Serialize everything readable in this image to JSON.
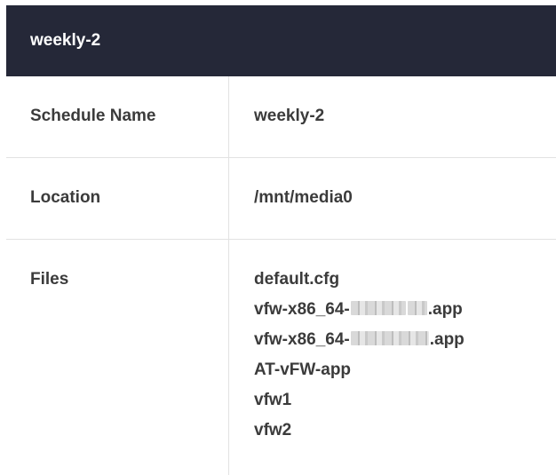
{
  "header": {
    "title": "weekly-2"
  },
  "details": {
    "schedule_name": {
      "label": "Schedule Name",
      "value": "weekly-2"
    },
    "location": {
      "label": "Location",
      "value": "/mnt/media0"
    },
    "files": {
      "label": "Files",
      "items": [
        "default.cfg",
        "vfw-x86_64-",
        ".app",
        "vfw-x86_64-",
        ".app",
        "AT-vFW-app",
        "vfw1",
        "vfw2"
      ]
    }
  }
}
